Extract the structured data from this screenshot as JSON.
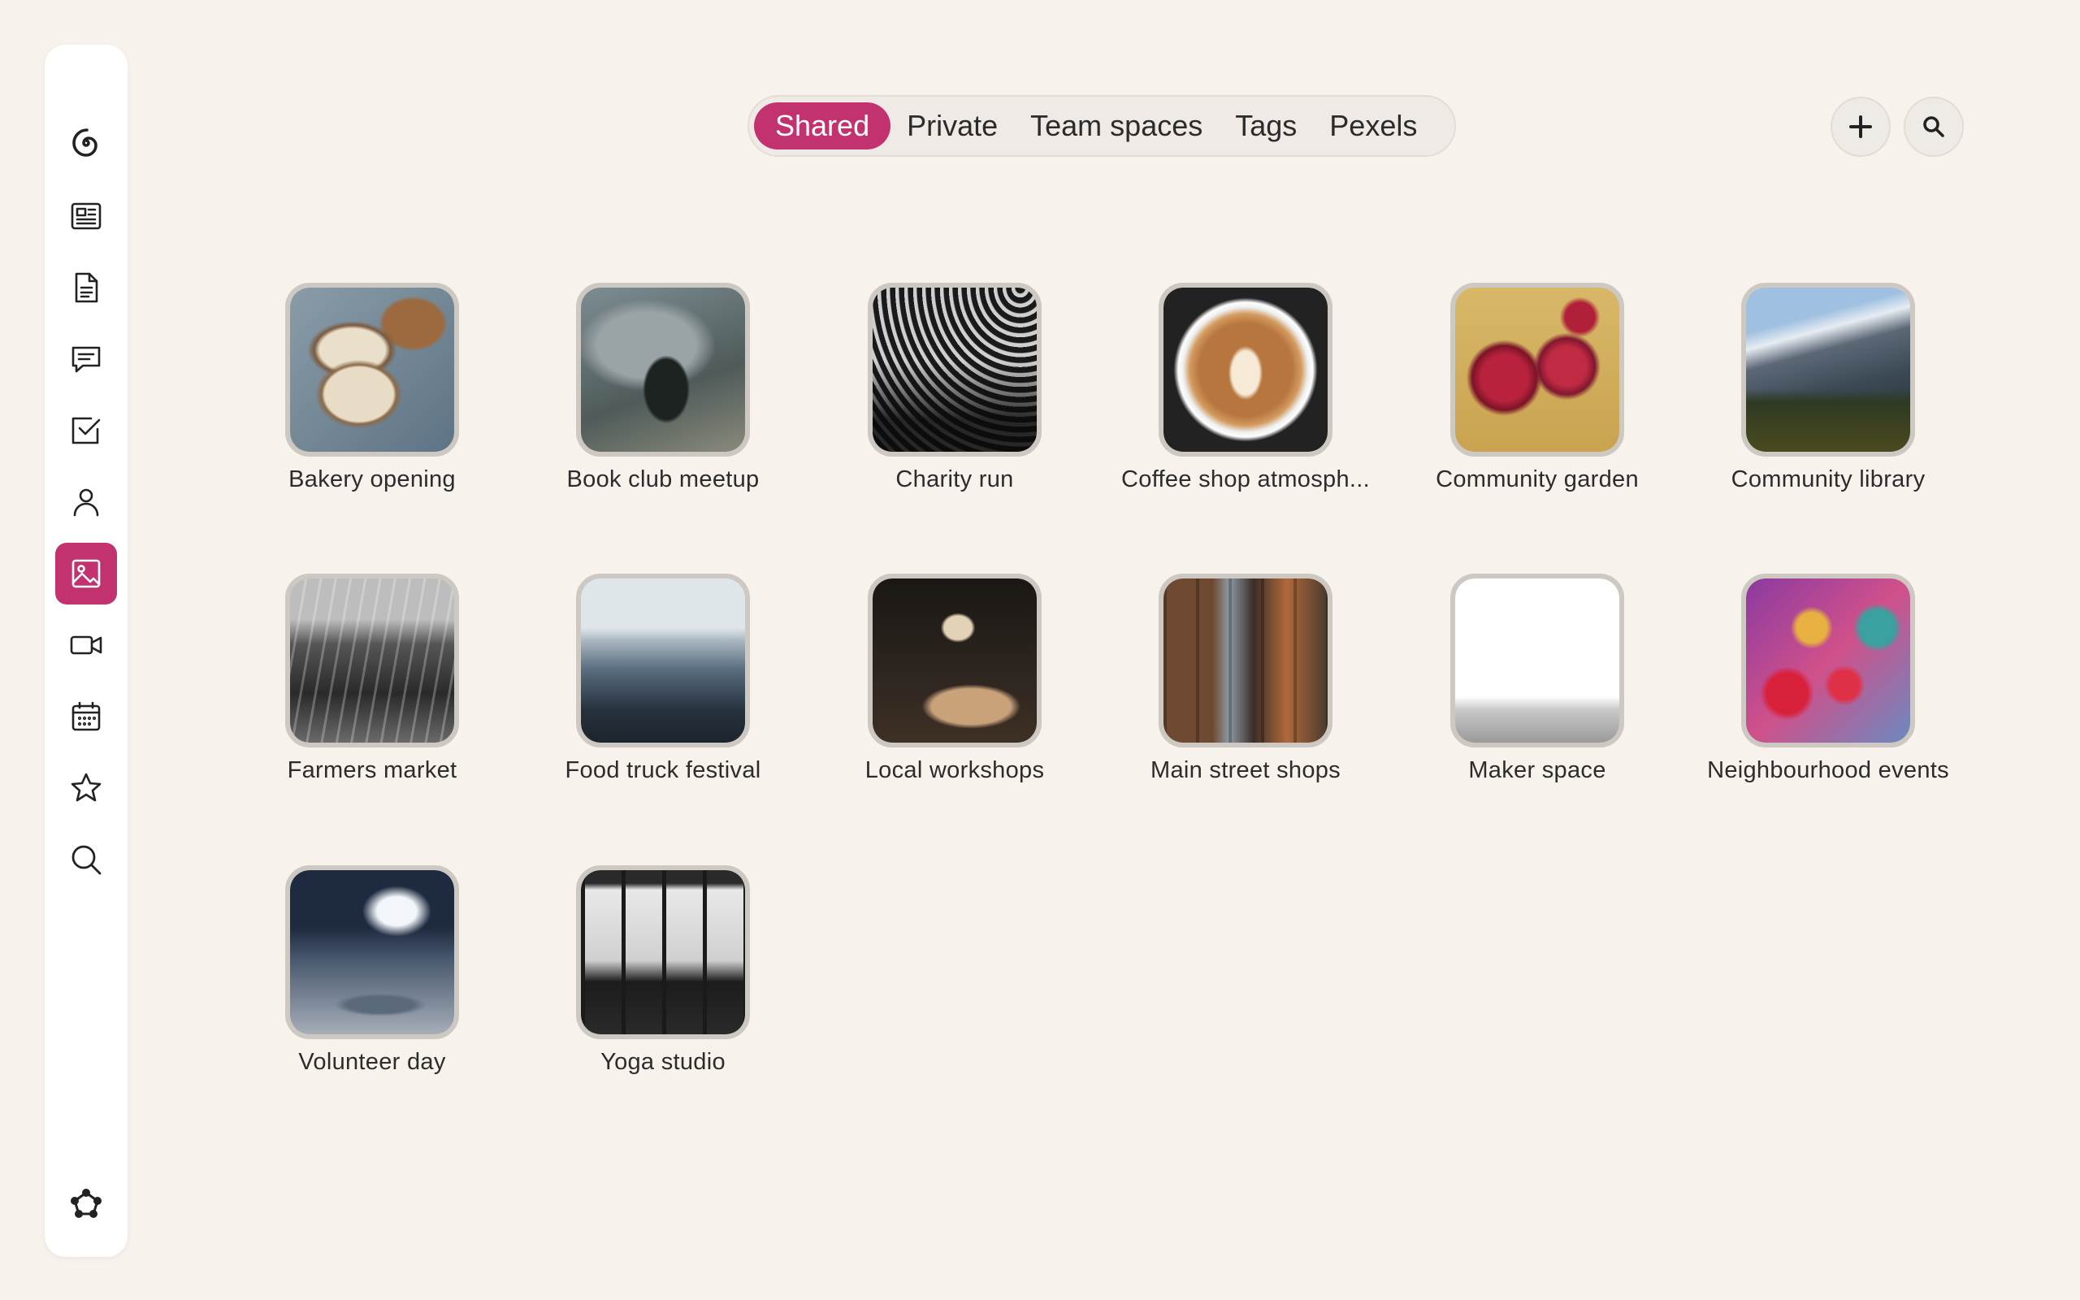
{
  "tabs": [
    {
      "label": "Shared",
      "active": true
    },
    {
      "label": "Private",
      "active": false
    },
    {
      "label": "Team spaces",
      "active": false
    },
    {
      "label": "Tags",
      "active": false
    },
    {
      "label": "Pexels",
      "active": false
    }
  ],
  "accent_color": "#c2326e",
  "sidebar": {
    "items": [
      {
        "icon": "spiral-logo-icon"
      },
      {
        "icon": "newspaper-icon"
      },
      {
        "icon": "document-icon"
      },
      {
        "icon": "chat-icon"
      },
      {
        "icon": "checkbox-icon"
      },
      {
        "icon": "person-icon"
      },
      {
        "icon": "image-icon",
        "active": true
      },
      {
        "icon": "video-icon"
      },
      {
        "icon": "calendar-icon"
      },
      {
        "icon": "star-icon"
      },
      {
        "icon": "search-icon"
      }
    ],
    "bottom_icon": "network-icon"
  },
  "toolbar": {
    "add_icon": "plus-icon",
    "search_icon": "search-icon"
  },
  "albums": [
    {
      "label": "Bakery opening"
    },
    {
      "label": "Book club meetup"
    },
    {
      "label": "Charity run"
    },
    {
      "label": "Coffee shop atmosph..."
    },
    {
      "label": "Community garden"
    },
    {
      "label": "Community library"
    },
    {
      "label": "Farmers market"
    },
    {
      "label": "Food truck festival"
    },
    {
      "label": "Local workshops"
    },
    {
      "label": "Main street shops"
    },
    {
      "label": "Maker space"
    },
    {
      "label": "Neighbourhood events"
    },
    {
      "label": "Volunteer day"
    },
    {
      "label": "Yoga studio"
    }
  ]
}
